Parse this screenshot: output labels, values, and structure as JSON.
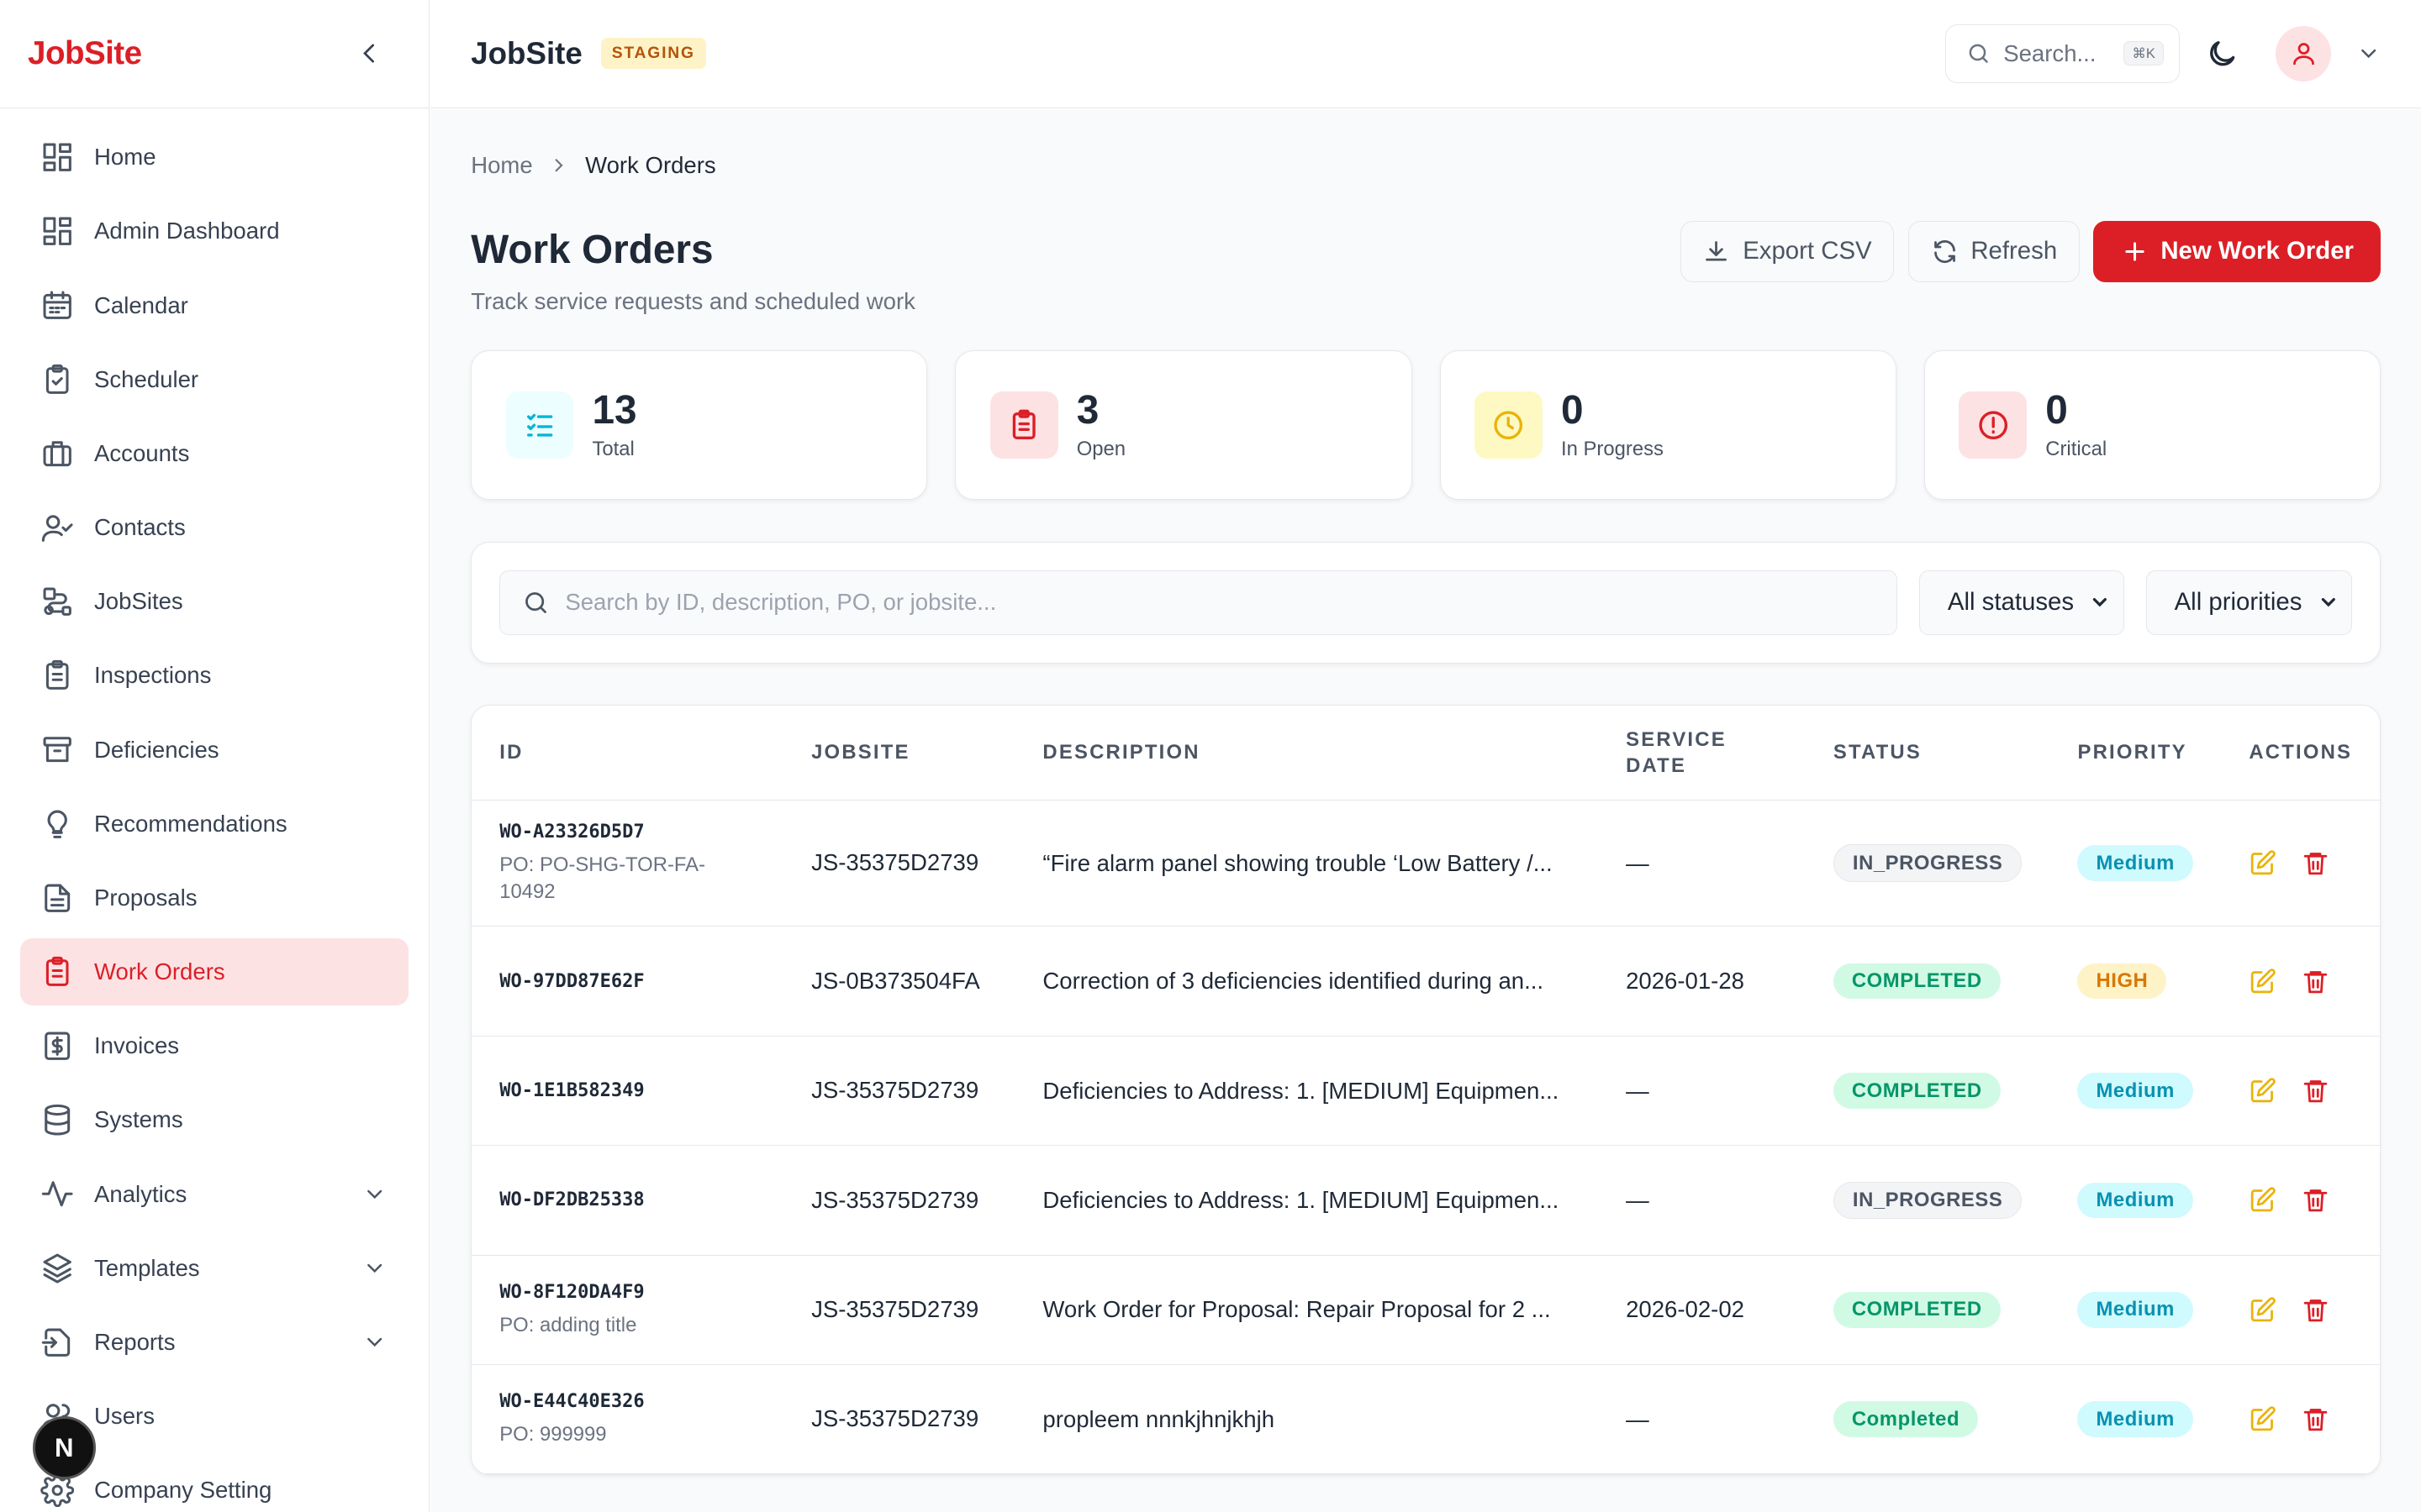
{
  "brand": {
    "logo": "JobSite",
    "accent": "#dc1f26"
  },
  "sidebar": {
    "items": [
      {
        "label": "Home",
        "icon": "grid-icon"
      },
      {
        "label": "Admin Dashboard",
        "icon": "grid-icon"
      },
      {
        "label": "Calendar",
        "icon": "calendar-icon"
      },
      {
        "label": "Scheduler",
        "icon": "clipboard-check-icon"
      },
      {
        "label": "Accounts",
        "icon": "briefcase-icon"
      },
      {
        "label": "Contacts",
        "icon": "user-check-icon"
      },
      {
        "label": "JobSites",
        "icon": "route-icon"
      },
      {
        "label": "Inspections",
        "icon": "clipboard-list-icon"
      },
      {
        "label": "Deficiencies",
        "icon": "archive-icon"
      },
      {
        "label": "Recommendations",
        "icon": "lightbulb-icon"
      },
      {
        "label": "Proposals",
        "icon": "file-text-icon"
      },
      {
        "label": "Work Orders",
        "icon": "clipboard-list-icon",
        "active": true
      },
      {
        "label": "Invoices",
        "icon": "dollar-file-icon"
      },
      {
        "label": "Systems",
        "icon": "database-icon"
      },
      {
        "label": "Analytics",
        "icon": "activity-icon",
        "expandable": true
      },
      {
        "label": "Templates",
        "icon": "layers-icon",
        "expandable": true
      },
      {
        "label": "Reports",
        "icon": "file-export-icon",
        "expandable": true
      },
      {
        "label": "Users",
        "icon": "users-icon"
      },
      {
        "label": "Company Setting",
        "icon": "gear-icon"
      }
    ],
    "floating_avatar": "N"
  },
  "topbar": {
    "title": "JobSite",
    "env_badge": "STAGING",
    "search_placeholder": "Search...",
    "search_shortcut": "⌘K"
  },
  "breadcrumb": {
    "home": "Home",
    "current": "Work Orders"
  },
  "page": {
    "title": "Work Orders",
    "subtitle": "Track service requests and scheduled work",
    "export_label": "Export CSV",
    "refresh_label": "Refresh",
    "new_label": "New Work Order"
  },
  "stats": [
    {
      "value": "13",
      "label": "Total",
      "color": "#06b6d4",
      "bg": "#ecfeff"
    },
    {
      "value": "3",
      "label": "Open",
      "color": "#dc1f26",
      "bg": "#fde2e4"
    },
    {
      "value": "0",
      "label": "In Progress",
      "color": "#eab308",
      "bg": "#fef9c3"
    },
    {
      "value": "0",
      "label": "Critical",
      "color": "#dc1f26",
      "bg": "#fde2e4"
    }
  ],
  "filters": {
    "search_placeholder": "Search by ID, description, PO, or jobsite...",
    "status_value": "All statuses",
    "priority_value": "All priorities"
  },
  "table": {
    "headers": [
      "ID",
      "JOBSITE",
      "DESCRIPTION",
      "SERVICE DATE",
      "STATUS",
      "PRIORITY",
      "ACTIONS"
    ],
    "rows": [
      {
        "id": "WO-A23326D5D7",
        "po": "PO: PO-SHG-TOR-FA-10492",
        "jobsite": "JS-35375D2739",
        "description": "“Fire alarm panel showing trouble ‘Low Battery /...",
        "service_date": "—",
        "status": "IN_PROGRESS",
        "status_type": "progress",
        "priority": "Medium",
        "priority_type": "medium"
      },
      {
        "id": "WO-97DD87E62F",
        "po": "",
        "jobsite": "JS-0B373504FA",
        "description": "Correction of 3 deficiencies identified during an...",
        "service_date": "2026-01-28",
        "status": "COMPLETED",
        "status_type": "completed",
        "priority": "HIGH",
        "priority_type": "high"
      },
      {
        "id": "WO-1E1B582349",
        "po": "",
        "jobsite": "JS-35375D2739",
        "description": "Deficiencies to Address: 1. [MEDIUM] Equipmen...",
        "service_date": "—",
        "status": "COMPLETED",
        "status_type": "completed",
        "priority": "Medium",
        "priority_type": "medium"
      },
      {
        "id": "WO-DF2DB25338",
        "po": "",
        "jobsite": "JS-35375D2739",
        "description": "Deficiencies to Address: 1. [MEDIUM] Equipmen...",
        "service_date": "—",
        "status": "IN_PROGRESS",
        "status_type": "progress",
        "priority": "Medium",
        "priority_type": "medium"
      },
      {
        "id": "WO-8F120DA4F9",
        "po": "PO: adding title",
        "jobsite": "JS-35375D2739",
        "description": "Work Order for Proposal: Repair Proposal for 2 ...",
        "service_date": "2026-02-02",
        "status": "COMPLETED",
        "status_type": "completed",
        "priority": "Medium",
        "priority_type": "medium"
      },
      {
        "id": "WO-E44C40E326",
        "po": "PO: 999999",
        "jobsite": "JS-35375D2739",
        "description": "propleem nnnkjhnjkhjh",
        "service_date": "—",
        "status": "Completed",
        "status_type": "completed",
        "priority": "Medium",
        "priority_type": "medium"
      }
    ]
  }
}
